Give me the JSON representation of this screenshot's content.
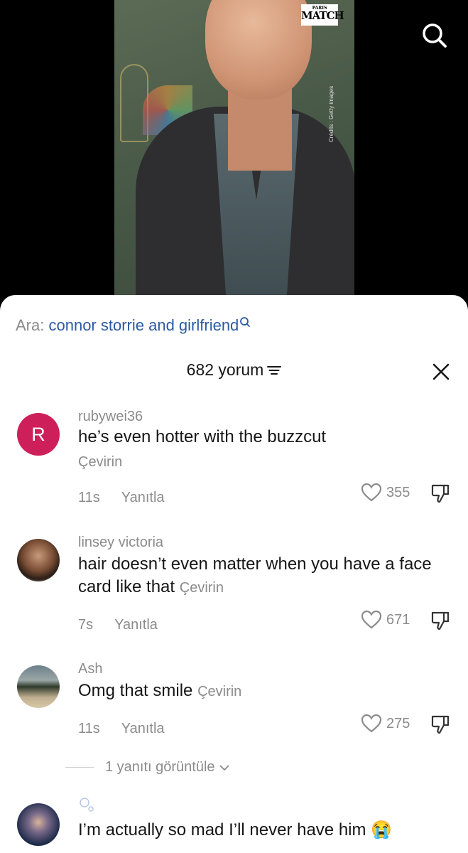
{
  "video": {
    "logo_top": "PARIS",
    "logo_main": "MATCH",
    "credits": "Crédits : Getty images"
  },
  "search_suggestion": {
    "prefix": "Ara:",
    "query": "connor storrie and girlfriend"
  },
  "comments_header": {
    "count_label": "682 yorum"
  },
  "comments": [
    {
      "avatar_letter": "R",
      "username": "rubywei36",
      "text": "he’s even hotter with the buzzcut",
      "translate": "Çevirin",
      "time": "11s",
      "reply": "Yanıtla",
      "likes": "355"
    },
    {
      "username": "linsey victoria",
      "text": "hair doesn’t even matter when you have a face card like that",
      "translate": "Çevirin",
      "time": "7s",
      "reply": "Yanıtla",
      "likes": "671"
    },
    {
      "username": "Ash",
      "text": "Omg that smile",
      "translate": "Çevirin",
      "time": "11s",
      "reply": "Yanıtla",
      "likes": "275",
      "view_replies": "1 yanıtı görüntüle"
    },
    {
      "username": "",
      "text": "I’m actually so mad I’ll never have him 😭"
    }
  ]
}
